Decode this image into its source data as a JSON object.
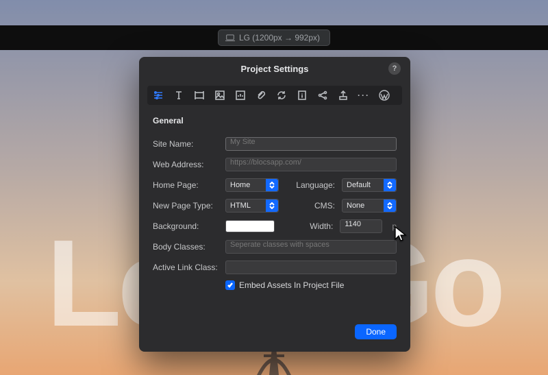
{
  "topbar": {
    "breakpoint_label": "LG (1200px → 992px)"
  },
  "background": {
    "bigtext": "Let's Go"
  },
  "modal": {
    "title": "Project Settings",
    "help": "?",
    "section": "General",
    "labels": {
      "site_name": "Site Name:",
      "web_address": "Web Address:",
      "home_page": "Home Page:",
      "language": "Language:",
      "new_page_type": "New Page Type:",
      "cms": "CMS:",
      "background": "Background:",
      "width": "Width:",
      "body_classes": "Body Classes:",
      "active_link_class": "Active Link Class:"
    },
    "placeholders": {
      "site_name": "My Site",
      "web_address": "https://blocsapp.com/",
      "body_classes": "Seperate classes with spaces"
    },
    "values": {
      "home_page": "Home",
      "language": "Default",
      "new_page_type": "HTML",
      "cms": "None",
      "width": "1140",
      "width_unit": "p",
      "background_swatch": "#ffffff"
    },
    "checkbox_label": "Embed Assets In Project File",
    "done_label": "Done"
  }
}
